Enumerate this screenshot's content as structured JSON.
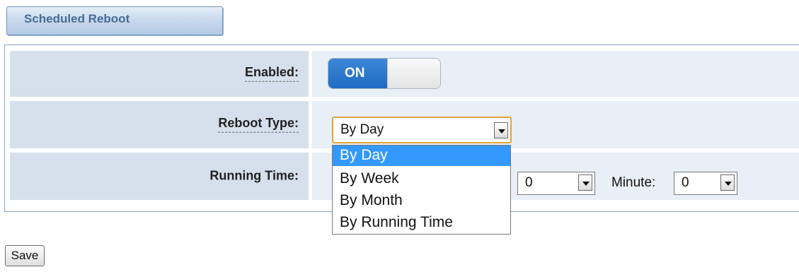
{
  "section": {
    "title": "Scheduled Reboot"
  },
  "fields": {
    "enabled": {
      "label": "Enabled:",
      "toggle_state": "ON"
    },
    "reboot_type": {
      "label": "Reboot Type:",
      "selected": "By Day",
      "options": [
        "By Day",
        "By Week",
        "By Month",
        "By Running Time"
      ],
      "highlighted_option": "By Day"
    },
    "running_time": {
      "label": "Running Time:",
      "hour_value": "0",
      "minute_label": "Minute:",
      "minute_value": "0"
    }
  },
  "actions": {
    "save_label": "Save"
  },
  "colors": {
    "accent": "#1f6cc3",
    "highlight": "#3399ff",
    "label_cell_bg": "#d5e0ec",
    "value_cell_bg": "#e9eff6",
    "tab_text": "#486d96",
    "focus_border": "#e3a23c"
  }
}
